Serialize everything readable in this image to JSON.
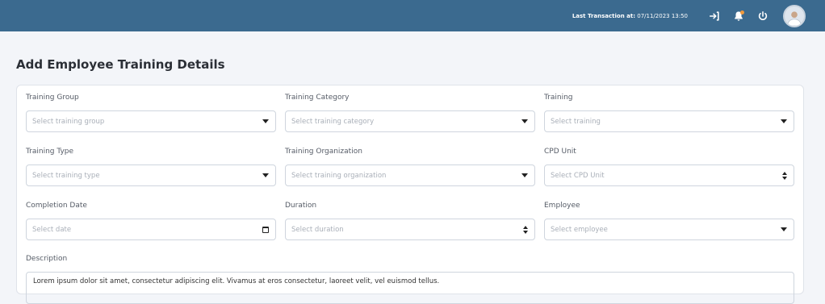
{
  "topbar": {
    "last_transaction_label": "Last Transaction at:",
    "last_transaction_value": "07/11/2023 13:50",
    "icons": [
      "sign-in-icon",
      "bell-icon",
      "power-icon",
      "avatar"
    ]
  },
  "page": {
    "title": "Add Employee Training Details"
  },
  "form": {
    "training_group": {
      "label": "Training Group",
      "placeholder": "Select training group"
    },
    "training_category": {
      "label": "Training Category",
      "placeholder": "Select training category"
    },
    "training": {
      "label": "Training",
      "placeholder": "Select training"
    },
    "training_type": {
      "label": "Training Type",
      "placeholder": "Select training type"
    },
    "training_organization": {
      "label": "Training Organization",
      "placeholder": "Select training organization"
    },
    "cpd_unit": {
      "label": "CPD Unit",
      "placeholder": "Select CPD Unit"
    },
    "completion_date": {
      "label": "Completion Date",
      "placeholder": "Select date"
    },
    "duration": {
      "label": "Duration",
      "placeholder": "Select duration"
    },
    "employee": {
      "label": "Employee",
      "placeholder": "Select employee"
    },
    "description": {
      "label": "Description",
      "value": "Lorem ipsum dolor sit amet, consectetur adipiscing elit. Vivamus at eros consectetur, laoreet velit, vel euismod tellus."
    }
  },
  "colors": {
    "topbar": "#3b6a8f",
    "bell_badge": "#f19a3e"
  }
}
